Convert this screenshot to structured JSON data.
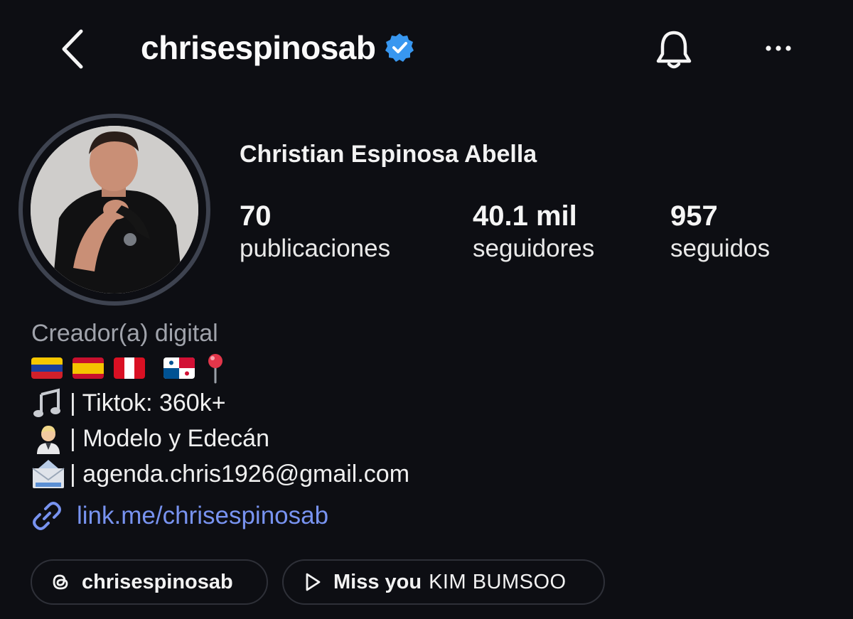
{
  "header": {
    "username": "chrisespinosab",
    "back_icon": "chevron-left-icon",
    "verified_icon": "verified-badge-icon",
    "bell_icon": "bell-icon",
    "more_icon": "more-horizontal-icon",
    "accent_color": "#3897f0"
  },
  "profile": {
    "full_name": "Christian Espinosa Abella",
    "stats": [
      {
        "value": "70",
        "label": "publicaciones"
      },
      {
        "value": "40.1 mil",
        "label": "seguidores"
      },
      {
        "value": "957",
        "label": "seguidos"
      }
    ]
  },
  "bio": {
    "category": "Creador(a) digital",
    "flags": [
      "venezuela-flag-icon",
      "spain-flag-icon",
      "peru-flag-icon",
      "panama-flag-icon",
      "pin-icon"
    ],
    "lines": [
      {
        "icon": "music-notes-icon",
        "text": "| Tiktok: 360k+"
      },
      {
        "icon": "person-icon",
        "text": "| Modelo y Edecán"
      },
      {
        "icon": "envelope-icon",
        "text": "| agenda.chris1926@gmail.com"
      }
    ],
    "link": "link.me/chrisespinosab",
    "link_color": "#7893f0"
  },
  "pills": {
    "threads_label": "chrisespinosab",
    "music_song": "Miss you",
    "music_artist": "KIM BUMSOO"
  }
}
